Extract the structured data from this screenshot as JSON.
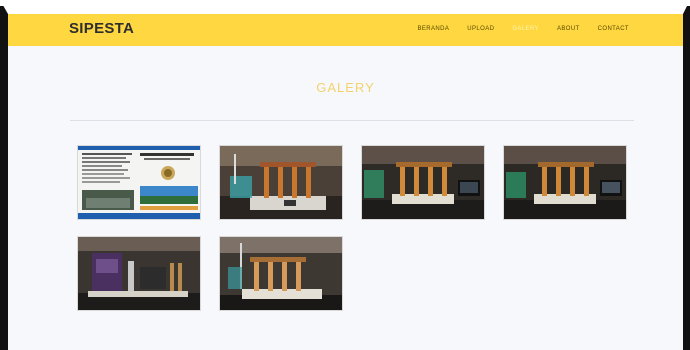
{
  "navbar": {
    "brand": "SIPESTA",
    "items": [
      {
        "label": "BERANDA",
        "active": false
      },
      {
        "label": "UPLOAD",
        "active": false
      },
      {
        "label": "GALERY",
        "active": true
      },
      {
        "label": "ABOUT",
        "active": false
      },
      {
        "label": "CONTACT",
        "active": false
      }
    ]
  },
  "page": {
    "title": "GALERY"
  },
  "gallery": {
    "images": [
      {
        "name": "gallery-image-brochure"
      },
      {
        "name": "gallery-image-device-1"
      },
      {
        "name": "gallery-image-device-2"
      },
      {
        "name": "gallery-image-device-3"
      },
      {
        "name": "gallery-image-device-4"
      },
      {
        "name": "gallery-image-device-5"
      }
    ]
  },
  "colors": {
    "navbar_bg": "#ffd740",
    "title": "#f3d26b",
    "page_bg": "#f7f8fb"
  }
}
